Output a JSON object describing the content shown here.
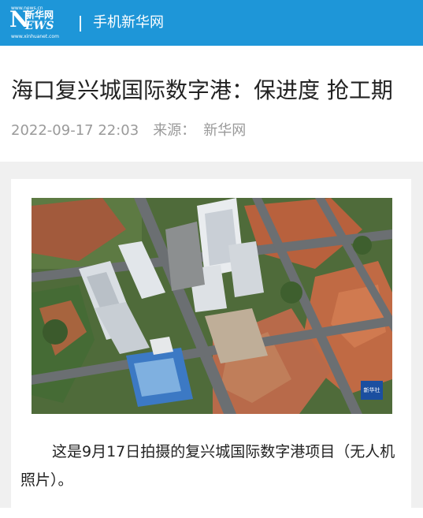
{
  "header": {
    "logo": {
      "top_small": "www.news.cn",
      "cn_text": "新华网",
      "bottom_small": "www.xinhuanet.com"
    },
    "site_name": "手机新华网",
    "background_color": "#1e96d8"
  },
  "article": {
    "title": "海口复兴城国际数字港：保进度 抢工期",
    "datetime": "2022-09-17 22:03",
    "source_label": "来源：",
    "source_name": "新华网",
    "photo": {
      "description_icon": "aerial-construction-photo",
      "watermark": "新华社"
    },
    "caption": "这是9月17日拍摄的复兴城国际数字港项目（无人机照片）。"
  }
}
